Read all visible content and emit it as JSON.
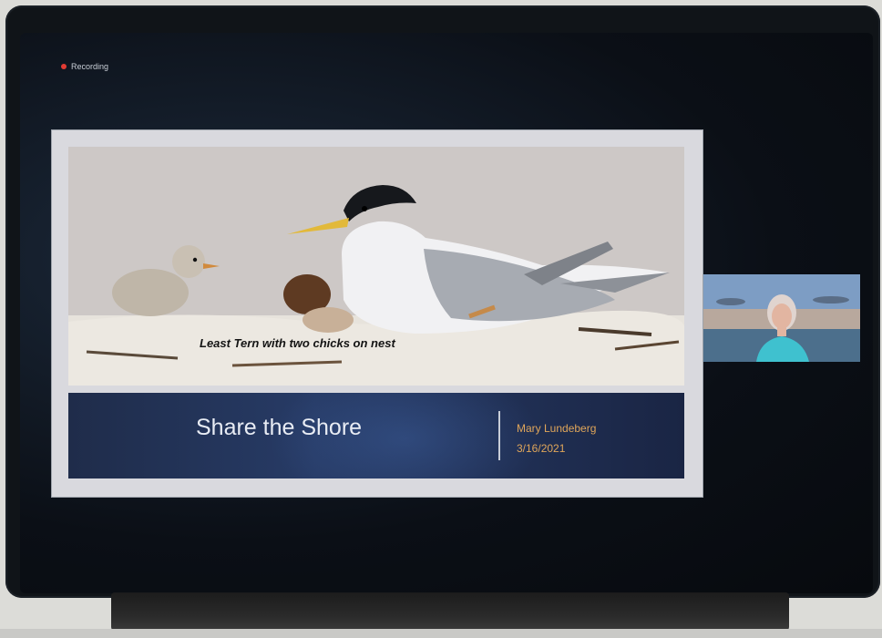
{
  "window": {
    "recording_label": "Recording"
  },
  "slide": {
    "caption": "Least Tern with two chicks on nest",
    "title": "Share the Shore",
    "presenter_name": "Mary Lundeberg",
    "date": "3/16/2021"
  },
  "colors": {
    "recording_dot": "#e23b33",
    "title_band": "#273b66",
    "presenter_text": "#e0a65a",
    "camera_led": "#27e06a"
  }
}
